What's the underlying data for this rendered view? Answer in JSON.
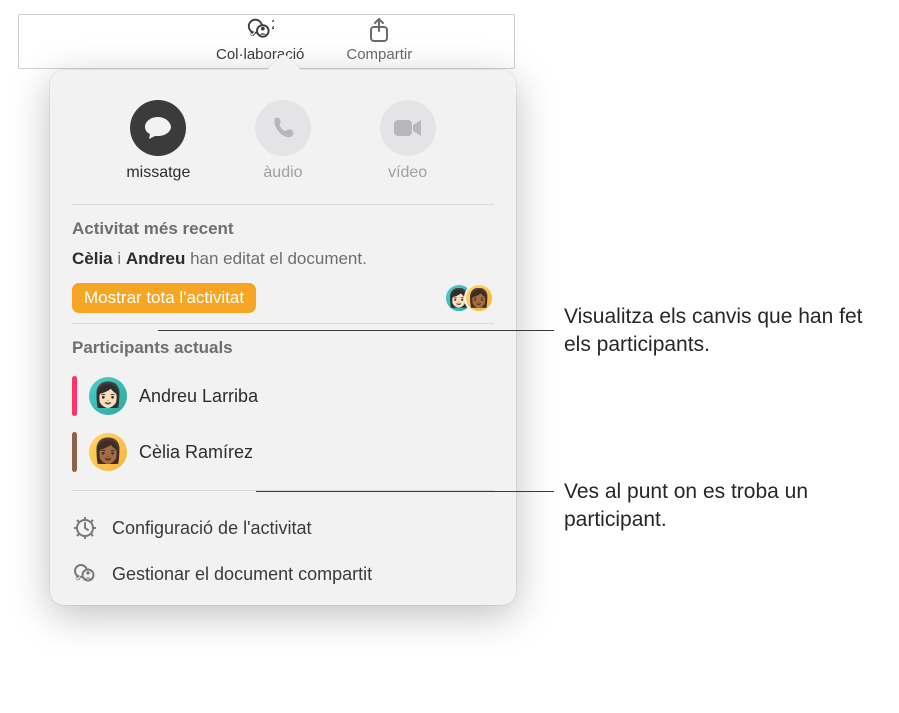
{
  "toolbar": {
    "collaboration": {
      "label": "Col·laboració",
      "count": "2"
    },
    "share": {
      "label": "Compartir"
    }
  },
  "popover": {
    "contact": {
      "message": "missatge",
      "audio": "àudio",
      "video": "vídeo"
    },
    "activity": {
      "heading": "Activitat més recent",
      "name1": "Cèlia",
      "conj": " i ",
      "name2": "Andreu",
      "rest": " han editat el document.",
      "show_all": "Mostrar tota l'activitat"
    },
    "participants": {
      "heading": "Participants actuals",
      "list": [
        {
          "name": "Andreu Larriba",
          "bar": "bar-pink",
          "avclass": "av-teal",
          "face": "👩🏻"
        },
        {
          "name": "Cèlia Ramírez",
          "bar": "bar-brown",
          "avclass": "av-yellow",
          "face": "👩🏾"
        }
      ]
    },
    "settings": {
      "activity": "Configuració de l'activitat",
      "manage": "Gestionar el document compartit"
    }
  },
  "callouts": {
    "c1": "Visualitza els canvis que han fet els participants.",
    "c2": "Ves al punt on es troba un participant."
  }
}
